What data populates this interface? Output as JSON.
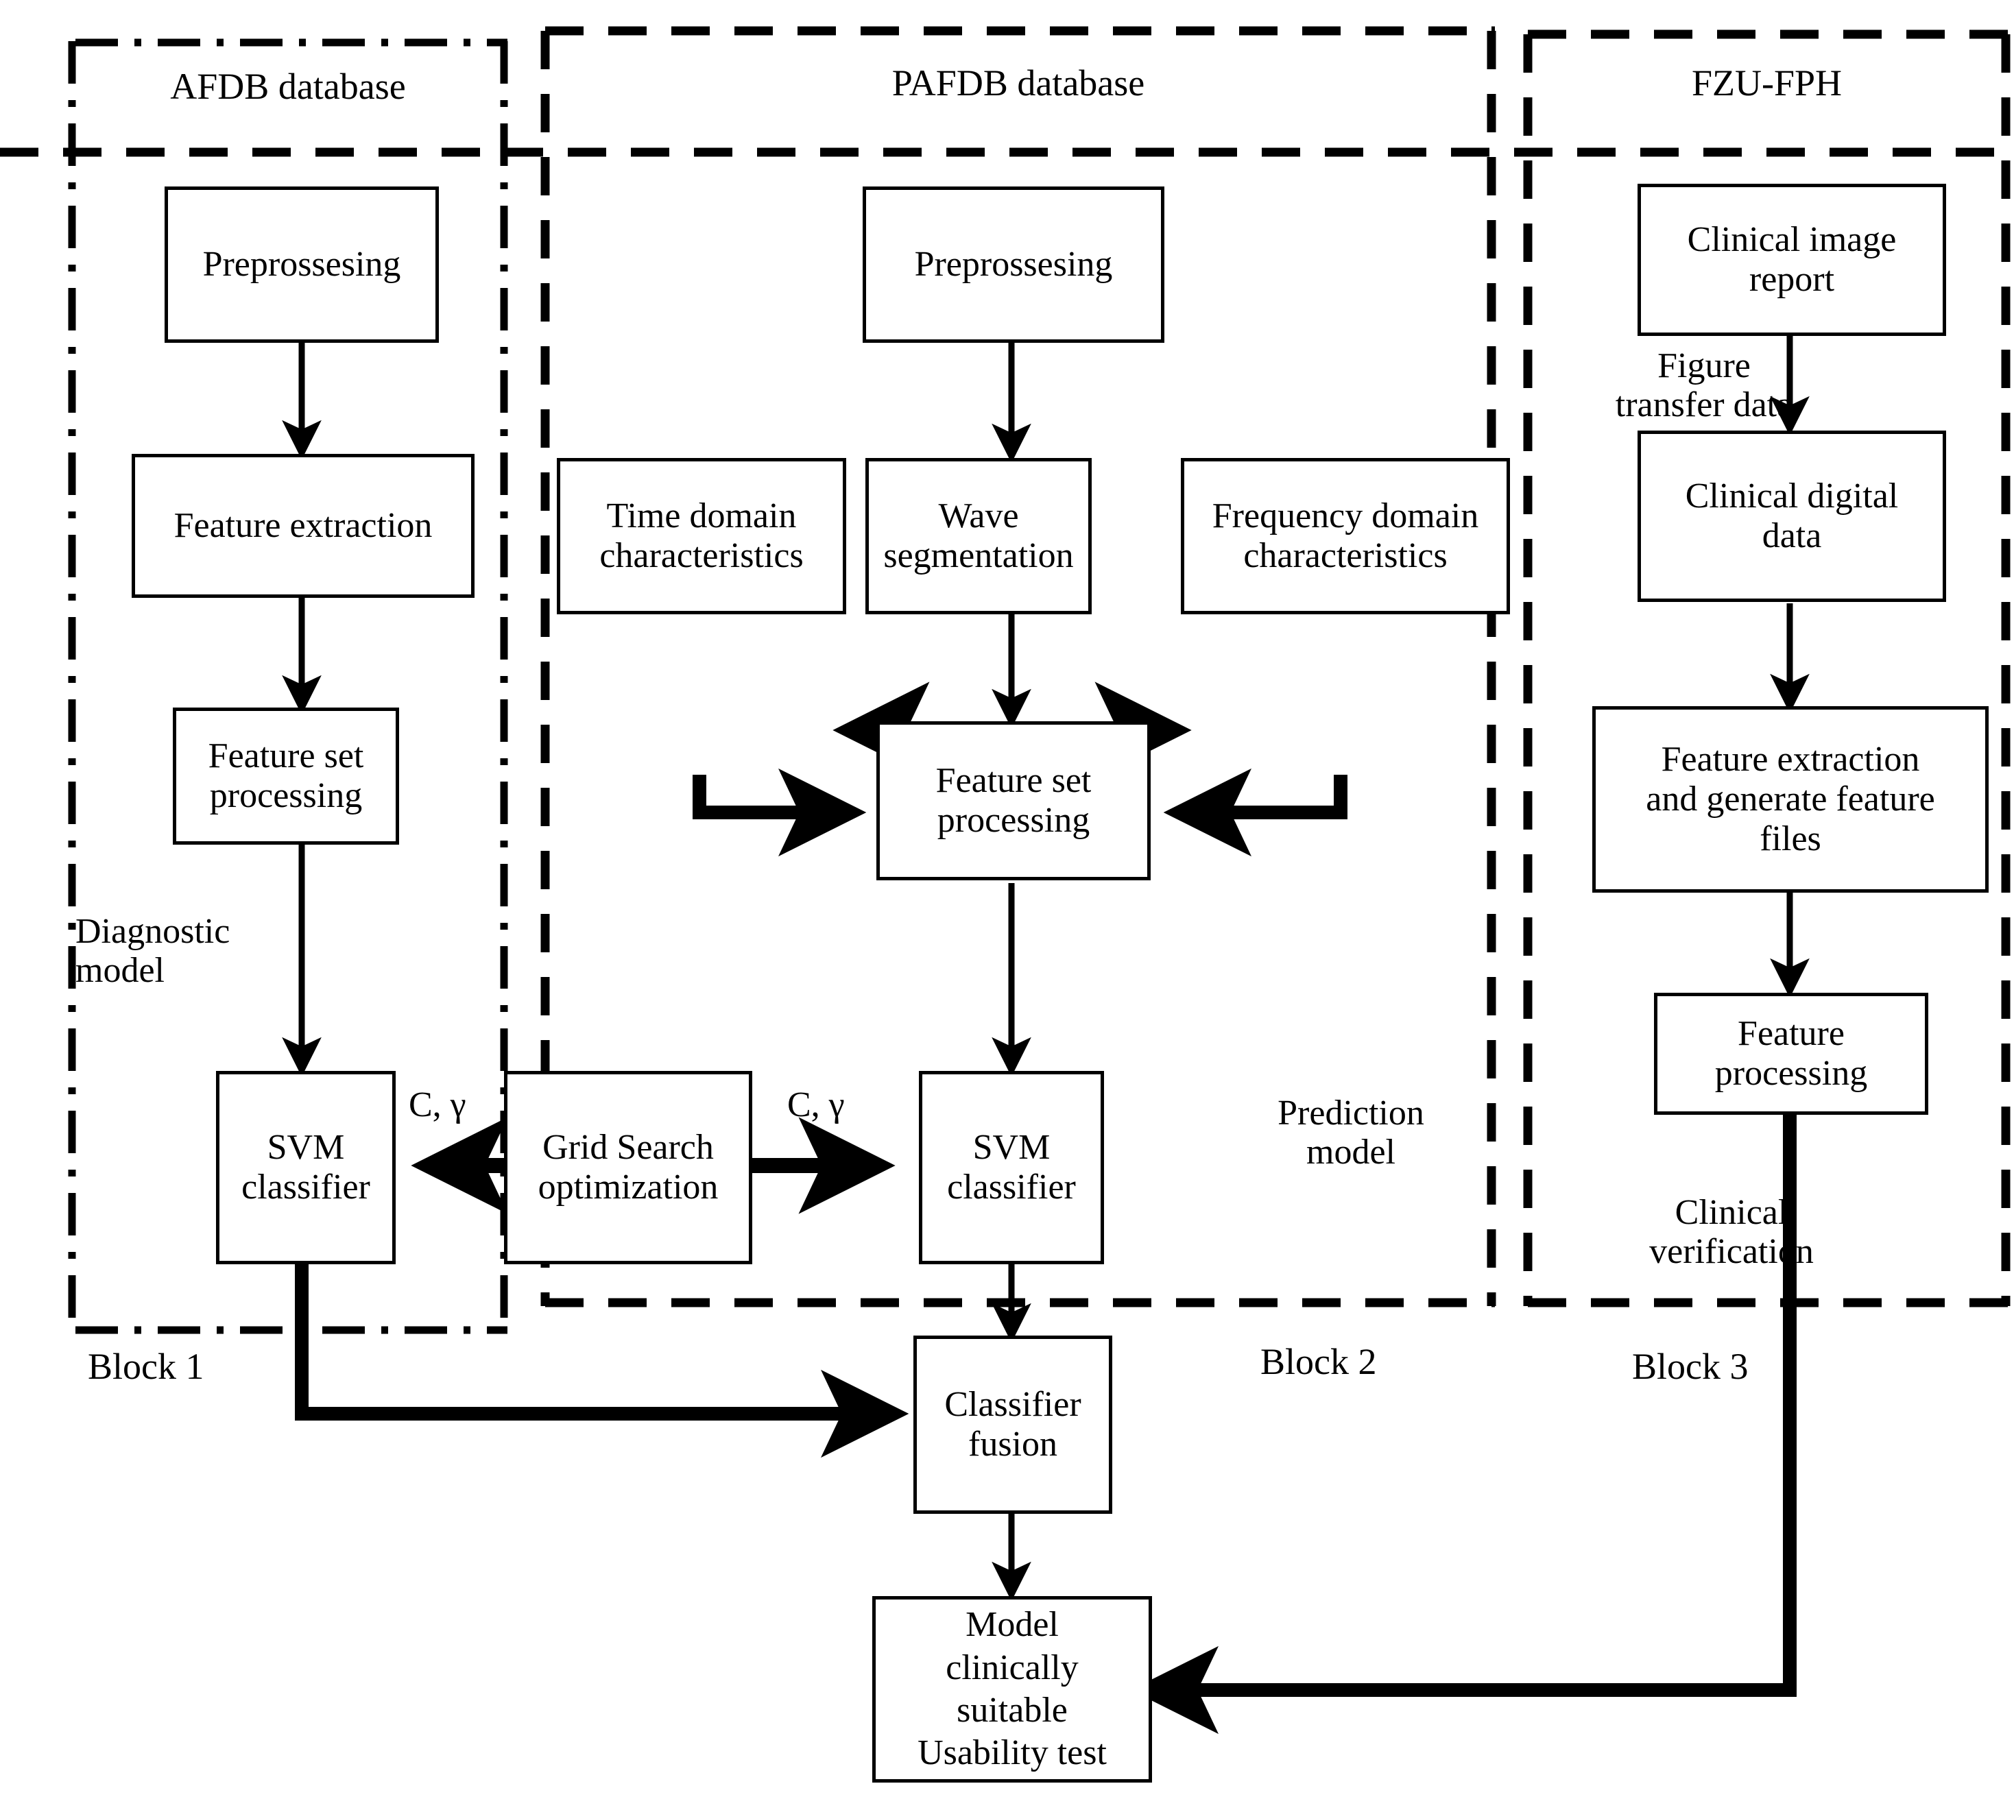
{
  "figure": {
    "kind": "flowchart",
    "zones": [
      {
        "id": "afdb",
        "title": "AFDB database"
      },
      {
        "id": "pafdb",
        "title": "PAFDB database"
      },
      {
        "id": "fzu",
        "title": "FZU-FPH"
      }
    ],
    "block_labels": [
      {
        "id": "block1",
        "label": "Block 1"
      },
      {
        "id": "block2",
        "label": "Block 2"
      },
      {
        "id": "block3",
        "label": "Block 3"
      }
    ],
    "annotations": [
      {
        "id": "diagnostic-model",
        "text": "Diagnostic\nmodel"
      },
      {
        "id": "prediction-model",
        "text": "Prediction\nmodel"
      },
      {
        "id": "clinical-verification",
        "text": "Clinical\nverification"
      },
      {
        "id": "figure-transfer-data",
        "text": "Figure\ntransfer data"
      }
    ],
    "edge_labels": [
      {
        "id": "c-gamma-left",
        "text": "C, γ"
      },
      {
        "id": "c-gamma-right",
        "text": "C, γ"
      }
    ],
    "nodes": [
      {
        "id": "afdb-preprocessing",
        "label": "Preprossesing"
      },
      {
        "id": "afdb-feature-extract",
        "label": "Feature extraction"
      },
      {
        "id": "afdb-feature-set",
        "label": "Feature set\nprocessing"
      },
      {
        "id": "afdb-svm",
        "label": "SVM\nclassifier"
      },
      {
        "id": "pafdb-preprocessing",
        "label": "Preprossesing"
      },
      {
        "id": "time-domain",
        "label": "Time domain\ncharacteristics"
      },
      {
        "id": "wave-segmentation",
        "label": "Wave\nsegmentation"
      },
      {
        "id": "freq-domain",
        "label": "Frequency domain\ncharacteristics"
      },
      {
        "id": "pafdb-feature-set",
        "label": "Feature set\nprocessing"
      },
      {
        "id": "grid-search",
        "label": "Grid Search\noptimization"
      },
      {
        "id": "pafdb-svm",
        "label": "SVM\nclassifier"
      },
      {
        "id": "classifier-fusion",
        "label": "Classifier\nfusion"
      },
      {
        "id": "model-usability",
        "label": "Model\nclinically\nsuitable\nUsability test"
      },
      {
        "id": "clinical-image-report",
        "label": "Clinical image\nreport"
      },
      {
        "id": "clinical-digital-data",
        "label": "Clinical digital\ndata"
      },
      {
        "id": "feature-extract-files",
        "label": "Feature extraction\nand generate feature\nfiles"
      },
      {
        "id": "feature-processing",
        "label": "Feature\nprocessing"
      }
    ],
    "colors": {
      "stroke": "#000000",
      "fill": "#ffffff",
      "text": "#000000"
    }
  }
}
